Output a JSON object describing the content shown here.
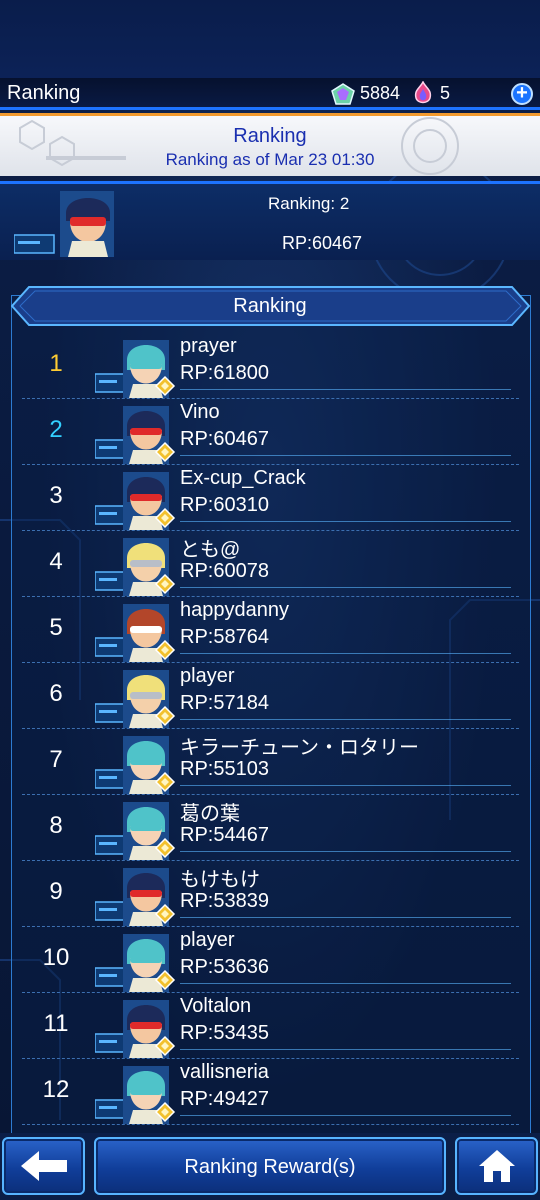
{
  "header": {
    "title": "Ranking",
    "gems": "5884",
    "tickets": "5"
  },
  "banner": {
    "title": "Ranking",
    "subtitle": "Ranking as of Mar 23 01:30"
  },
  "player": {
    "rank": "Ranking: 2",
    "rp": "RP:60467",
    "avatar": "red-masked-boy-avatar"
  },
  "list": {
    "title": "Ranking",
    "entries": [
      {
        "rank": "1",
        "name": "prayer",
        "rp": "RP:61800",
        "avatar": "teal-hair-girl-avatar",
        "rank_color": "#ffcc33"
      },
      {
        "rank": "2",
        "name": "Vino",
        "rp": "RP:60467",
        "avatar": "red-masked-boy-avatar",
        "rank_color": "#33d0ff"
      },
      {
        "rank": "3",
        "name": "Ex-cup_Crack",
        "rp": "RP:60310",
        "avatar": "red-masked-boy-avatar",
        "rank_color": "#ffffff"
      },
      {
        "rank": "4",
        "name": "とも@",
        "rp": "RP:60078",
        "avatar": "blond-masked-avatar",
        "rank_color": "#ffffff"
      },
      {
        "rank": "5",
        "name": "happydanny",
        "rp": "RP:58764",
        "avatar": "brown-hair-boy-avatar",
        "rank_color": "#ffffff"
      },
      {
        "rank": "6",
        "name": "player",
        "rp": "RP:57184",
        "avatar": "blond-masked-avatar",
        "rank_color": "#ffffff"
      },
      {
        "rank": "7",
        "name": "キラーチューン・ロタリー",
        "rp": "RP:55103",
        "avatar": "teal-hair-girl-avatar",
        "rank_color": "#ffffff"
      },
      {
        "rank": "8",
        "name": "葛の葉",
        "rp": "RP:54467",
        "avatar": "teal-hair-girl-avatar",
        "rank_color": "#ffffff"
      },
      {
        "rank": "9",
        "name": "もけもけ",
        "rp": "RP:53839",
        "avatar": "red-masked-boy-avatar",
        "rank_color": "#ffffff"
      },
      {
        "rank": "10",
        "name": "player",
        "rp": "RP:53636",
        "avatar": "teal-hair-girl-avatar",
        "rank_color": "#ffffff"
      },
      {
        "rank": "11",
        "name": "Voltalon",
        "rp": "RP:53435",
        "avatar": "red-masked-boy-avatar",
        "rank_color": "#ffffff"
      },
      {
        "rank": "12",
        "name": "vallisneria",
        "rp": "RP:49427",
        "avatar": "teal-hair-girl-avatar",
        "rank_color": "#ffffff"
      }
    ]
  },
  "footer": {
    "reward_label": "Ranking Reward(s)",
    "back_icon": "arrow-left-icon",
    "home_icon": "home-icon"
  },
  "colors": {
    "accent": "#1d73ff",
    "banner_text": "#1a2fb0",
    "orange_rule": "#f29a2e",
    "gold_rank": "#ffcc33",
    "cyan_rank": "#33d0ff"
  }
}
